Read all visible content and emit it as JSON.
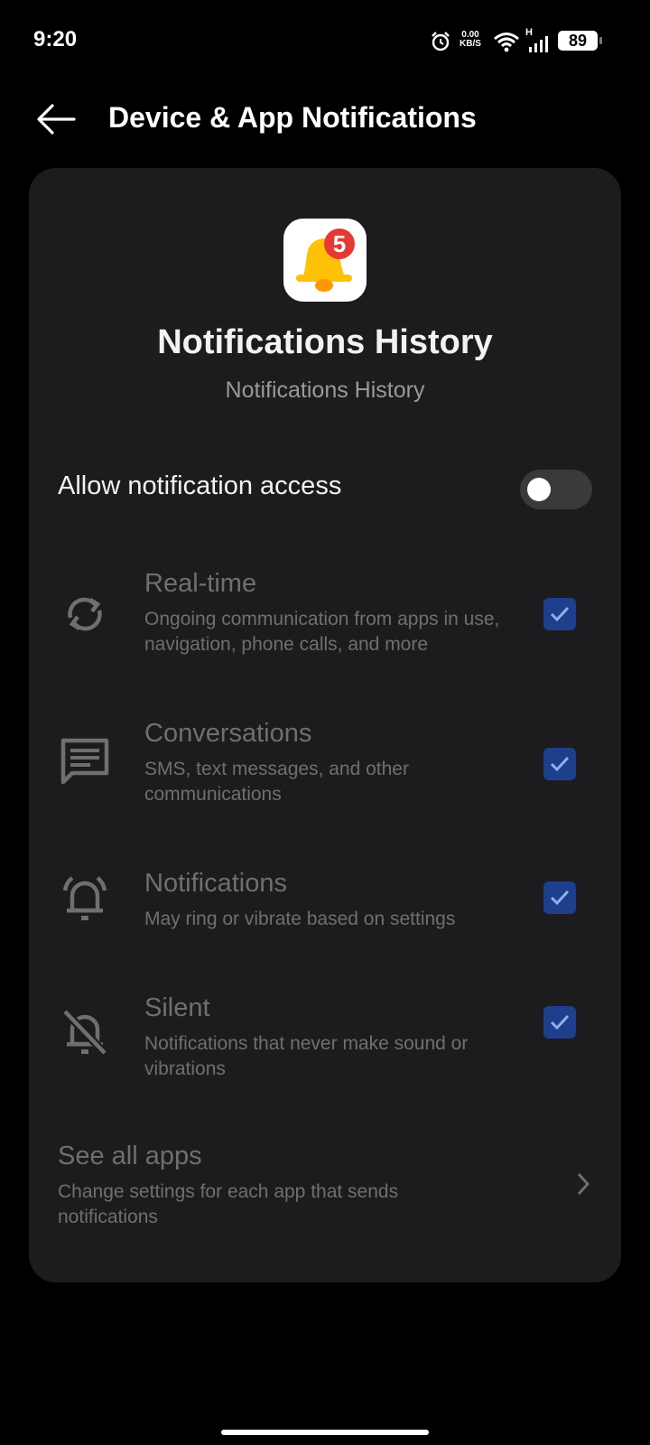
{
  "status_bar": {
    "time": "9:20",
    "speed_value": "0.00",
    "speed_unit": "KB/S",
    "network_type": "H",
    "battery": "89"
  },
  "header": {
    "title": "Device & App Notifications"
  },
  "app": {
    "name": "Notifications History",
    "subtitle": "Notifications History",
    "badge_count": "5",
    "icon": "bell-icon"
  },
  "allow_access": {
    "label": "Allow notification access",
    "enabled": false
  },
  "options": [
    {
      "title": "Real-time",
      "description": "Ongoing communication from apps in use, navigation, phone calls, and more",
      "checked": true,
      "icon": "sync-icon"
    },
    {
      "title": "Conversations",
      "description": "SMS, text messages, and other communications",
      "checked": true,
      "icon": "message-icon"
    },
    {
      "title": "Notifications",
      "description": "May ring or vibrate based on settings",
      "checked": true,
      "icon": "ringing-bell-icon"
    },
    {
      "title": "Silent",
      "description": "Notifications that never make sound or vibrations",
      "checked": true,
      "icon": "bell-off-icon"
    }
  ],
  "see_all": {
    "title": "See all apps",
    "description": "Change settings for each app that sends notifications"
  },
  "colors": {
    "background": "#000000",
    "card": "#1c1c1e",
    "checkbox": "#1d3f8c",
    "bell": "#ffc107",
    "badge": "#e53935"
  }
}
